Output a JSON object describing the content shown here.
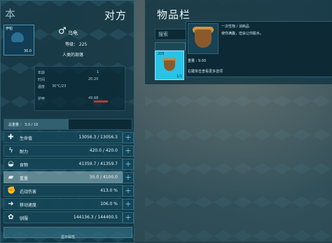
{
  "left_panel": {
    "tab_label": "本",
    "title": "对方",
    "mini_card": {
      "label": "伊帕",
      "level_num": "30.0"
    },
    "name": "乌龟",
    "gender_symbol": "♂",
    "level_text": "等级： 225",
    "tribe": "人类的部落",
    "info_rows": [
      {
        "label": "年龄",
        "value": "1"
      },
      {
        "label": "时间",
        "value": "20:20"
      },
      {
        "label": "温度",
        "value": "36°C/23"
      },
      {
        "label": "护甲",
        "value": "49.68"
      }
    ],
    "status_bar": {
      "label": "总重量 ： 3.0 / 10"
    },
    "stats": [
      {
        "label": "生命值",
        "value": "13056.3 / 13056.3",
        "icon": "plus-icon"
      },
      {
        "label": "耐力",
        "value": "420.0 / 420.0",
        "icon": "lightning-icon"
      },
      {
        "label": "食物",
        "value": "41359.7 / 41359.7",
        "icon": "drumstick-icon"
      },
      {
        "label": "重量",
        "value": "30.0 / 4100.0",
        "icon": "weight-icon"
      },
      {
        "label": "近战伤害",
        "value": "413.0 %",
        "icon": "fist-icon"
      },
      {
        "label": "移动速度",
        "value": "106.0 %",
        "icon": "boot-icon"
      },
      {
        "label": "驯服",
        "value": "144136.3 / 144400.5",
        "icon": "paw-icon"
      }
    ],
    "bottom_button": "显示属性"
  },
  "right_panel": {
    "title": "物品栏",
    "search_placeholder": "搜索",
    "item": {
      "category": "一次性物 / 消耗品",
      "description": "使你满腹，但会让你脱水。",
      "weight_label": "重量 : 9.00",
      "note": "右键单击查看更多选项",
      "slot_count": "1/1",
      "slot_weight": "205"
    }
  }
}
